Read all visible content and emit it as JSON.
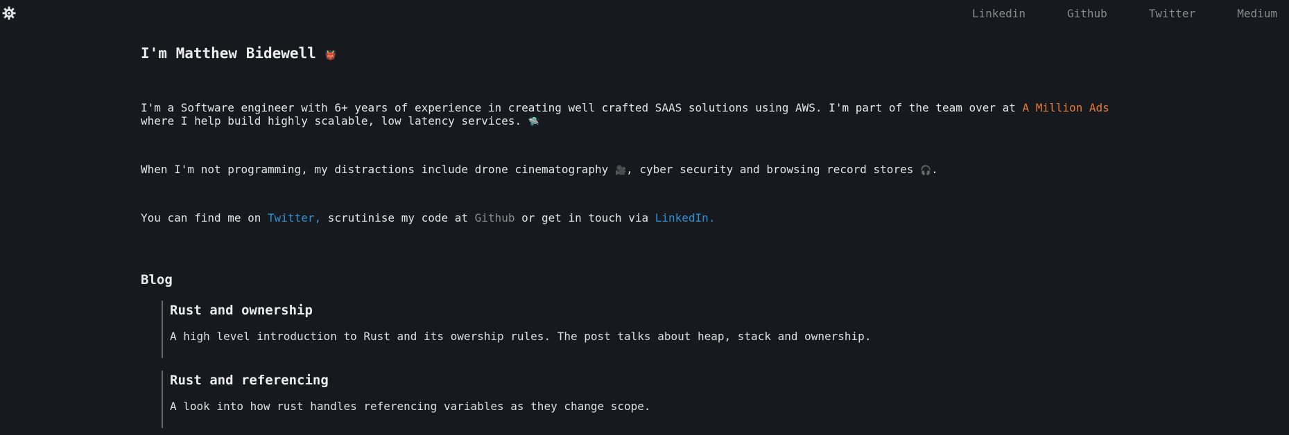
{
  "nav": {
    "theme_toggle": "gear-icon",
    "links": [
      "Linkedin",
      "Github",
      "Twitter",
      "Medium"
    ]
  },
  "intro": {
    "title": "I'm Matthew Bidewell",
    "title_emoji": "👹",
    "p1_a": "I'm a Software engineer with 6+ years of experience in creating well crafted SAAS solutions using AWS. I'm part of the team over at ",
    "p1_link": "A Million Ads",
    "p1_b": "where I help build highly scalable, low latency services. ",
    "p1_emoji": "🛸",
    "p2_a": "When I'm not programming, my distractions include drone cinematography ",
    "p2_emoji1": "🎥",
    "p2_b": ", cyber security and browsing record stores ",
    "p2_emoji2": "🎧",
    "p2_c": ".",
    "p3_a": "You can find me on ",
    "p3_link1": "Twitter,",
    "p3_b": " scrutinise my code at ",
    "p3_link2": "Github",
    "p3_c": " or get in touch via ",
    "p3_link3": "LinkedIn."
  },
  "blog": {
    "heading": "Blog",
    "posts": [
      {
        "title": "Rust and ownership",
        "description": "A high level introduction to Rust and its owership rules. The post talks about heap, stack and ownership."
      },
      {
        "title": "Rust and referencing",
        "description": "A look into how rust handles referencing variables as they change scope."
      }
    ]
  },
  "colors": {
    "background": "#16191d",
    "accent_orange": "#e8793a",
    "link_blue": "#2f8fd6"
  }
}
